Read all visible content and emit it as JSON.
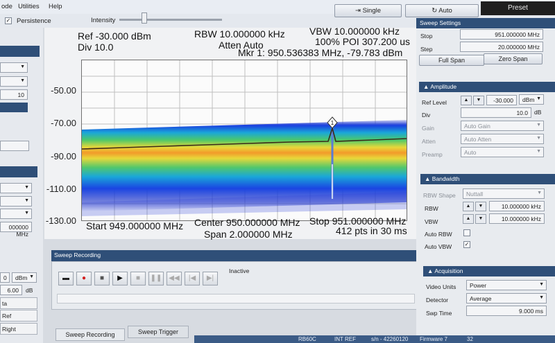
{
  "menu": {
    "items": [
      "ode",
      "Utilities",
      "Help"
    ]
  },
  "toolbar": {
    "persistence_label": "Persistence",
    "intensity_label": "Intensity",
    "single_label": "Single",
    "auto_label": "Auto",
    "preset_label": "Preset"
  },
  "spectrum": {
    "ref": "Ref -30.000 dBm",
    "div": "Div 10.0",
    "rbw": "RBW 10.000000 kHz",
    "atten": "Atten Auto",
    "vbw": "VBW 10.000000 kHz",
    "poi": "100% POI 307.200 us",
    "marker": "Mkr 1: 950.536383 MHz, -79.783 dBm",
    "marker_num": "1",
    "yticks": [
      "-50.00",
      "-70.00",
      "-90.00",
      "-110.00",
      "-130.00"
    ],
    "start": "Start 949.000000 MHz",
    "center": "Center 950.000000 MHz",
    "stop": "Stop 951.000000 MHz",
    "span": "Span 2.000000 MHz",
    "pts": "412 pts in 30 ms"
  },
  "sweep_recording": {
    "title": "Sweep Recording",
    "status": "Inactive",
    "tab1": "Sweep Recording",
    "tab2": "Sweep Trigger"
  },
  "sweep_settings": {
    "title": "Sweep Settings",
    "stop_label": "Stop",
    "stop_value": "951.000000 MHz",
    "step_label": "Step",
    "step_value": "20.000000 MHz",
    "full_span": "Full Span",
    "zero_span": "Zero Span"
  },
  "amplitude": {
    "title": "Amplitude",
    "ref_level_label": "Ref Level",
    "ref_level_value": "-30.000",
    "ref_level_unit": "dBm",
    "div_label": "Div",
    "div_value": "10.0",
    "div_unit": "dB",
    "gain_label": "Gain",
    "gain_value": "Auto Gain",
    "atten_label": "Atten",
    "atten_value": "Auto Atten",
    "preamp_label": "Preamp",
    "preamp_value": "Auto"
  },
  "bandwidth": {
    "title": "Bandwidth",
    "shape_label": "RBW Shape",
    "shape_value": "Nuttall",
    "rbw_label": "RBW",
    "rbw_value": "10.000000 kHz",
    "vbw_label": "VBW",
    "vbw_value": "10.000000 kHz",
    "auto_rbw_label": "Auto RBW",
    "auto_vbw_label": "Auto VBW"
  },
  "acquisition": {
    "title": "Acquisition",
    "video_units_label": "Video Units",
    "video_units_value": "Power",
    "detector_label": "Detector",
    "detector_value": "Average",
    "swp_time_label": "Swp Time",
    "swp_time_value": "9.000 ms"
  },
  "left_panel": {
    "value_10": "10",
    "mhz_value": "000000 MHz",
    "unit_dbm": "dBm",
    "value_0": "0",
    "value_6": "6.00",
    "unit_db": "dB",
    "item_ta": "ta",
    "item_ref": "Ref",
    "item_right": "Right"
  },
  "status_bar": {
    "items": [
      "RB60C",
      "INT REF",
      "s/n - 42260120",
      "Firmware 7",
      "32"
    ]
  },
  "colors": {
    "accent": "#2f4f78",
    "trace": "#3a2a1a"
  }
}
